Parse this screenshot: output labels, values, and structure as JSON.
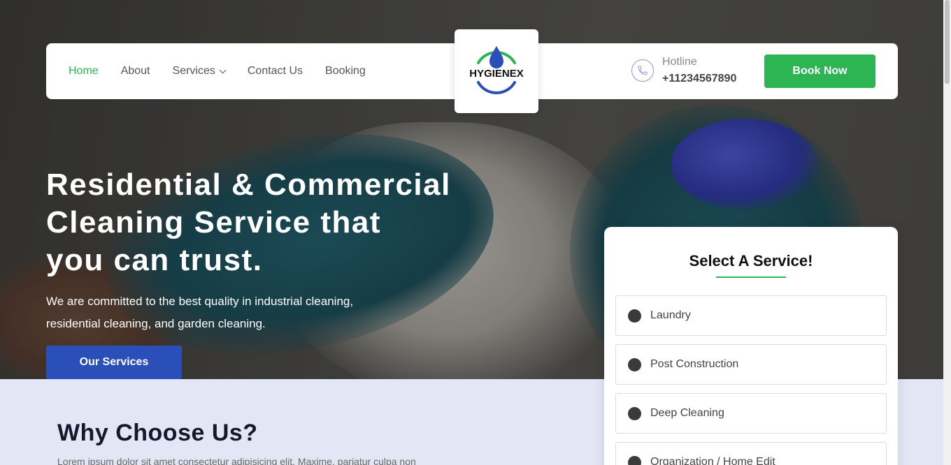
{
  "nav": {
    "items": [
      {
        "label": "Home",
        "active": true
      },
      {
        "label": "About"
      },
      {
        "label": "Services",
        "dropdown": true
      },
      {
        "label": "Contact Us"
      },
      {
        "label": "Booking"
      }
    ]
  },
  "logo": {
    "text": "HYGIENEX"
  },
  "hotline": {
    "label": "Hotline",
    "number": "+11234567890"
  },
  "book_button": "Book Now",
  "hero": {
    "title_lines": [
      "Residential & Commercial",
      "Cleaning Service that",
      "you can trust."
    ],
    "subtitle_lines": [
      "We are committed to the best quality in industrial cleaning,",
      "residential cleaning, and garden cleaning."
    ],
    "button": "Our Services"
  },
  "service_card": {
    "title": "Select A Service!",
    "options": [
      "Laundry",
      "Post Construction",
      "Deep Cleaning",
      "Organization / Home Edit"
    ]
  },
  "why": {
    "title": "Why Choose Us?",
    "text": "Lorem ipsum dolor sit amet consectetur adipisicing elit. Maxime, pariatur culpa non"
  },
  "colors": {
    "accent_green": "#2db453",
    "accent_blue": "#2a4fb8",
    "section_bg": "#e3e7f5"
  }
}
